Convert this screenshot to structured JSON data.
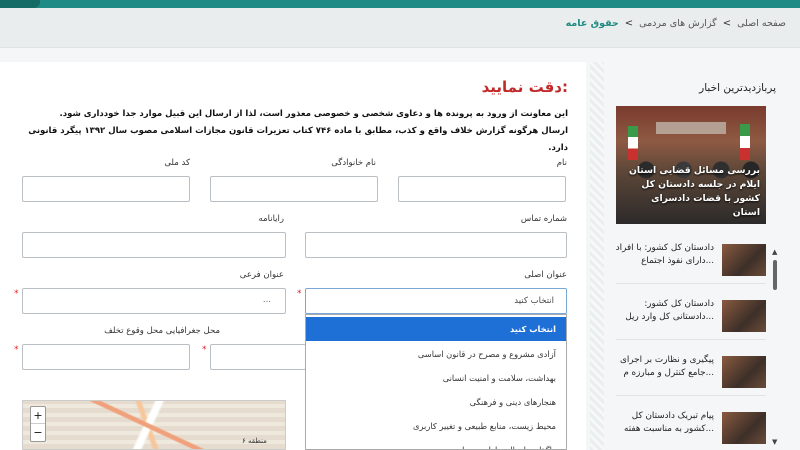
{
  "breadcrumb": {
    "items": [
      "صفحه اصلی",
      "گزارش های مردمی",
      "حقوق عامه"
    ]
  },
  "form": {
    "warning_title": "دقت نمایید:",
    "warning_line1": "این معاونت از ورود به پرونده ها و دعاوی شخصی و خصوصی معذور است، لذا از ارسال این قبیل موارد جدا خودداری شود.",
    "warning_line2": "ارسال هرگونه گزارش خلاف واقع و کذب، مطابق با ماده ۷۴۶ کتاب تعزیرات قانون مجازات اسلامی مصوب سال ۱۳۹۲ پیگرد قانونی دارد.",
    "labels": {
      "first_name": "نام",
      "last_name": "نام خانوادگی",
      "national_code": "کد ملی",
      "phone": "شماره تماس",
      "email": "رایانامه",
      "main_topic": "عنوان اصلی",
      "sub_topic": "عنوان فرعی",
      "location": "محل جغرافیایی محل وقوع تخلف"
    },
    "main_topic_selected": "انتخاب کنید",
    "sub_topic_value": "...",
    "dropdown_options": [
      "انتخاب کنید",
      "آزادی مشروع و مصرح در قانون اساسی",
      "بهداشت، سلامت و امنیت انسانی",
      "هنجارهای دینی و فرهنگی",
      "محیط زیست، منابع طبیعی و تغییر کاربری",
      "واگذاری اموال و اراضی دولتی"
    ]
  },
  "map": {
    "zoom_in": "+",
    "zoom_out": "−",
    "district_label": "منطقه ۶"
  },
  "sidebar": {
    "title": "پربازدیدترین اخبار",
    "feature_caption": "بررسی مسائل قضایی استان ایلام در جلسه دادستان کل کشور با قضات دادسرای استان",
    "news": [
      "دادستان کل کشور: با افراد دارای نفوذ اجتماع...",
      "دادستان کل کشور: دادستانی کل وارد ریل...",
      "پیگیری و نظارت بر اجرای جامع کنترل و مبارزه م...",
      "پیام تبریک دادستان کل کشور به مناسبت هفته..."
    ],
    "scroll_up": "▲",
    "scroll_down": "▼"
  }
}
